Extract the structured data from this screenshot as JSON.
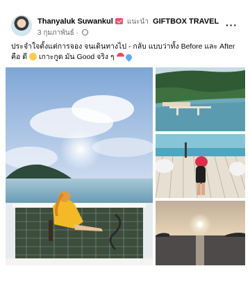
{
  "post": {
    "author_name": "Thanyaluk Suwankul",
    "recommends_label": "แนะนำ",
    "page_name": "GIFTBOX TRAVEL",
    "date": "3 กุมภาพันธ์",
    "separator": "·",
    "more_label": "···",
    "text_main": "ประจำใจตั้งแต่การจอง จนเดินทางไป - กลับ แบบว่าทั้ง Before และ After คือ ดี",
    "text_tail": "เกาะกูด มัน Good จริง ๆ",
    "icons": {
      "avatar": "profile-avatar",
      "badge": "verified-badge",
      "globe": "globe-icon",
      "emoji_1": "kiss-emoji",
      "emoji_2": "umbrella-emoji",
      "emoji_3": "blue-heart-emoji"
    }
  },
  "photos": [
    {
      "name": "photo-net-deck-sunset",
      "subject": "woman on net deck at sea"
    },
    {
      "name": "photo-island-pier",
      "subject": "aerial island pier"
    },
    {
      "name": "photo-deck-relax",
      "subject": "woman on wooden deck"
    },
    {
      "name": "photo-sunset-sea",
      "subject": "sunset over sea"
    }
  ],
  "colors": {
    "text": "#050505",
    "meta": "#65676b",
    "badge": "#f0506e"
  }
}
